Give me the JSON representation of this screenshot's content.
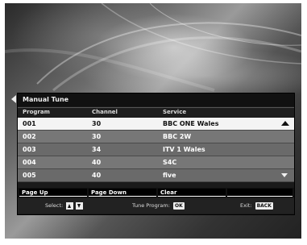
{
  "dialog": {
    "title": "Manual Tune"
  },
  "columns": {
    "program": "Program",
    "channel": "Channel",
    "service": "Service"
  },
  "rows": [
    {
      "program": "001",
      "channel": "30",
      "service": "BBC ONE Wales"
    },
    {
      "program": "002",
      "channel": "30",
      "service": "BBC 2W"
    },
    {
      "program": "003",
      "channel": "34",
      "service": "ITV 1 Wales"
    },
    {
      "program": "004",
      "channel": "40",
      "service": "S4C"
    },
    {
      "program": "005",
      "channel": "40",
      "service": "five"
    }
  ],
  "buttons": {
    "page_up": "Page Up",
    "page_down": "Page Down",
    "clear": "Clear"
  },
  "help": {
    "select": "Select:",
    "tune": "Tune Program:",
    "tune_key": "OK",
    "exit": "Exit:",
    "exit_key": "BACK"
  },
  "icons": {
    "back": "left-arrow-icon",
    "scroll_up": "scroll-up-icon",
    "scroll_down": "scroll-down-icon",
    "select_up": "up-arrow-key-icon",
    "select_down": "down-arrow-key-icon"
  }
}
